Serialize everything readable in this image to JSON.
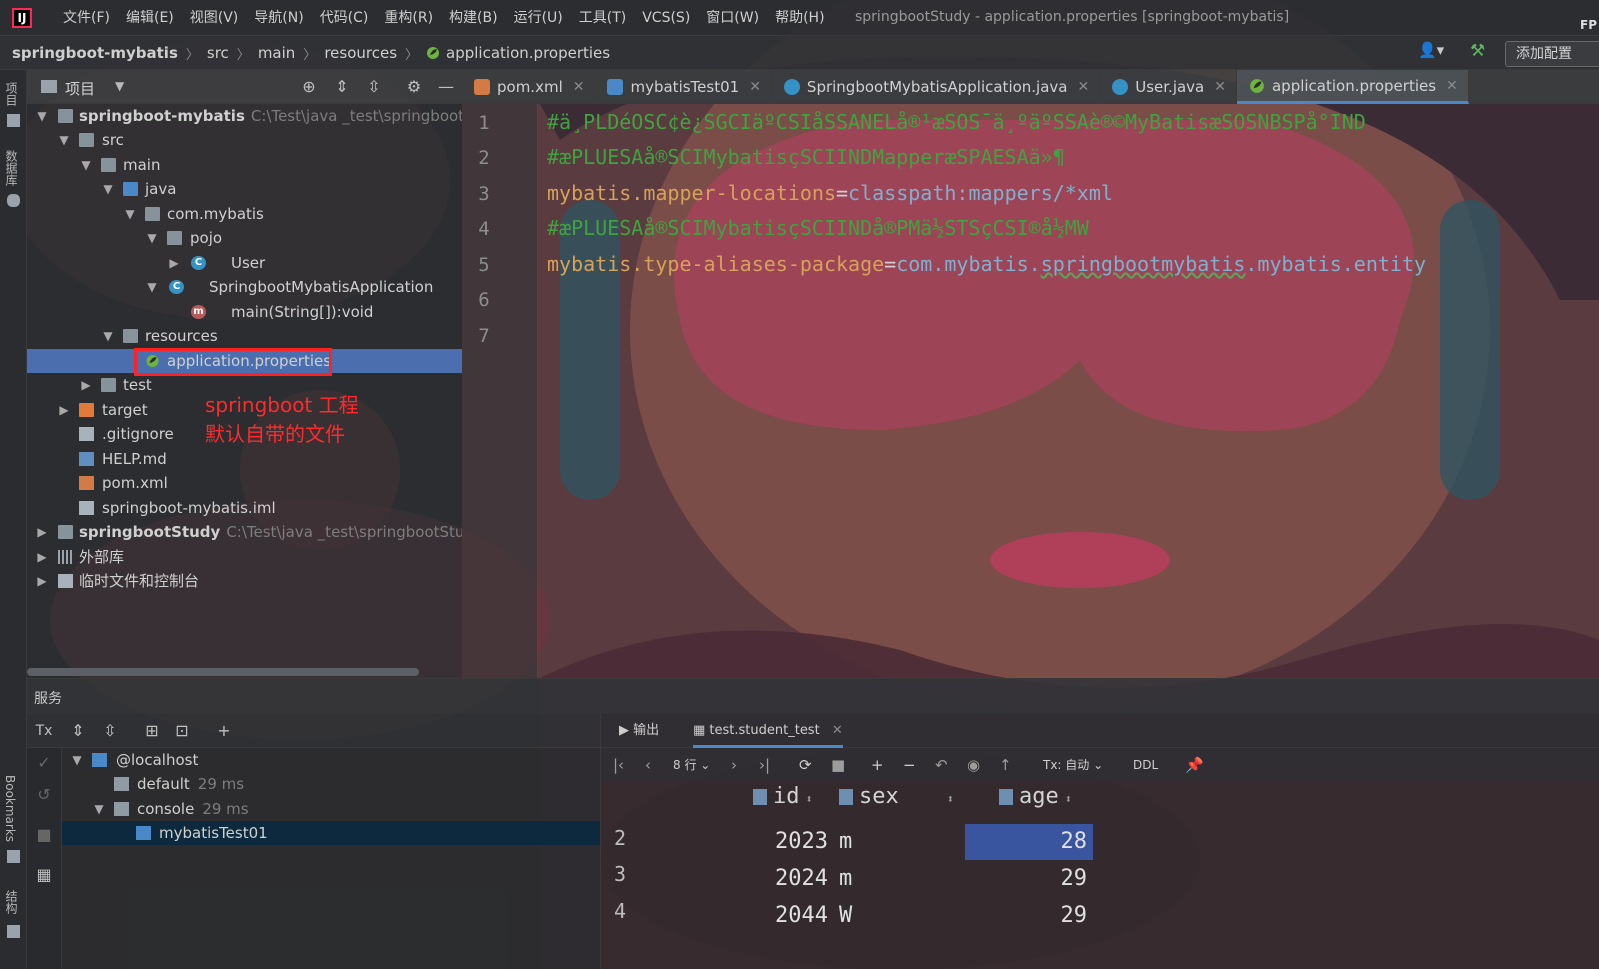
{
  "app": {
    "logo": "IJ",
    "window_title": "springbootStudy - application.properties [springboot-mybatis]",
    "corner_text": "FP"
  },
  "menu": [
    "文件(F)",
    "编辑(E)",
    "视图(V)",
    "导航(N)",
    "代码(C)",
    "重构(R)",
    "构建(B)",
    "运行(U)",
    "工具(T)",
    "VCS(S)",
    "窗口(W)",
    "帮助(H)"
  ],
  "breadcrumb": [
    "springboot-mybatis",
    "src",
    "main",
    "resources",
    "application.properties"
  ],
  "navbar": {
    "add_config": "添加配置"
  },
  "left_strip": {
    "project": "项目",
    "database": "数据库",
    "bookmarks": "Bookmarks",
    "structure": "结构"
  },
  "project_panel": {
    "title": "项目"
  },
  "tree": [
    {
      "label": "springboot-mybatis",
      "hint": "C:\\Test\\java _test\\springboot-m"
    },
    {
      "label": "src"
    },
    {
      "label": "main"
    },
    {
      "label": "java"
    },
    {
      "label": "com.mybatis"
    },
    {
      "label": "pojo"
    },
    {
      "label": "User"
    },
    {
      "label": "SpringbootMybatisApplication"
    },
    {
      "label": "main(String[]):void"
    },
    {
      "label": "resources"
    },
    {
      "label": "application.properties"
    },
    {
      "label": "test"
    },
    {
      "label": "target"
    },
    {
      "label": ".gitignore"
    },
    {
      "label": "HELP.md"
    },
    {
      "label": "pom.xml"
    },
    {
      "label": "springboot-mybatis.iml"
    },
    {
      "label": "springbootStudy",
      "hint": "C:\\Test\\java _test\\springbootStudy"
    },
    {
      "label": "外部库"
    },
    {
      "label": "临时文件和控制台"
    }
  ],
  "annotation": {
    "line1": "springboot 工程",
    "line2": "默认自带的文件"
  },
  "tabs": [
    {
      "label": "pom.xml"
    },
    {
      "label": "mybatisTest01"
    },
    {
      "label": "SpringbootMybatisApplication.java"
    },
    {
      "label": "User.java"
    },
    {
      "label": "application.properties"
    }
  ],
  "editor": {
    "line_numbers": [
      "1",
      "2",
      "3",
      "4",
      "5",
      "6",
      "7"
    ],
    "lines": {
      "l1": "#ä¸PLDéOSC¢è¿SGCIäºCSIåSSANELå®¹æSOS¯ä¸ºäºSSAè®©MyBatisæSOSNBSPå°IND",
      "l2": "#æPLUESAå®SCIMybatisçSCIINDMapperæSPAESAä»¶",
      "l3_key": "mybatis.mapper-locations",
      "l3_eq": "=",
      "l3_val": "classpath:mappers/*xml",
      "l4": "#æPLUESAå®SCIMybatisçSCIINDå®PMä½STSçCSI®å½MW",
      "l5_key": "mybatis.type-aliases-package",
      "l5_eq": "=",
      "l5_val_a": "com.mybatis.",
      "l5_val_b": "springbootmybatis",
      "l5_val_c": ".mybatis.entity"
    }
  },
  "services": {
    "title": "服务",
    "tx": "Tx",
    "tree": [
      {
        "label": "@localhost"
      },
      {
        "label": "default",
        "ms": "29 ms"
      },
      {
        "label": "console",
        "ms": "29 ms"
      },
      {
        "label": "mybatisTest01"
      }
    ]
  },
  "results": {
    "tab_output": "输出",
    "tab_table": "test.student_test",
    "rows_label": "8 行",
    "tx_label": "Tx: 自动",
    "ddl": "DDL",
    "columns": [
      "id",
      "sex",
      "age"
    ],
    "rows": [
      {
        "n": "2",
        "id": "2023",
        "sex": "m",
        "age": "28"
      },
      {
        "n": "3",
        "id": "2024",
        "sex": "m",
        "age": "29"
      },
      {
        "n": "4",
        "id": "2044",
        "sex": "W",
        "age": "29"
      }
    ]
  },
  "colors": {
    "selection": "#4b6eaf",
    "annotation_red": "#ff2b2b",
    "comment_green": "#3fa33f",
    "key_orange": "#d6a25a",
    "value_blue": "#7fb0d0"
  }
}
